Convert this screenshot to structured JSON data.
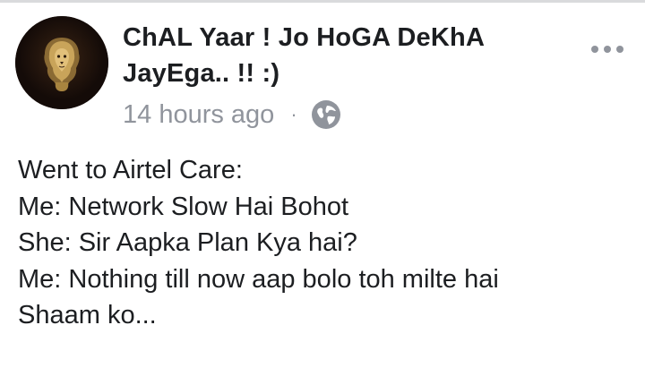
{
  "post": {
    "author": "ChAL Yaar ! Jo HoGA DeKhA JayEga.. !! :)",
    "timestamp": "14 hours ago",
    "separator": "·",
    "privacy_icon": "globe-icon",
    "more_icon": "more-horizontal-icon",
    "avatar_icon": "golden-lion-avatar",
    "body_lines": [
      "Went to Airtel Care:",
      "Me: Network Slow Hai Bohot",
      "She: Sir Aapka Plan Kya hai?",
      "Me: Nothing till now aap bolo toh milte hai",
      "Shaam ko..."
    ]
  },
  "colors": {
    "text": "#1c1e21",
    "meta": "#90949c",
    "divider": "#d9dadc",
    "avatar_bg": "#140b08",
    "lion_gold": "#c9a45a"
  }
}
